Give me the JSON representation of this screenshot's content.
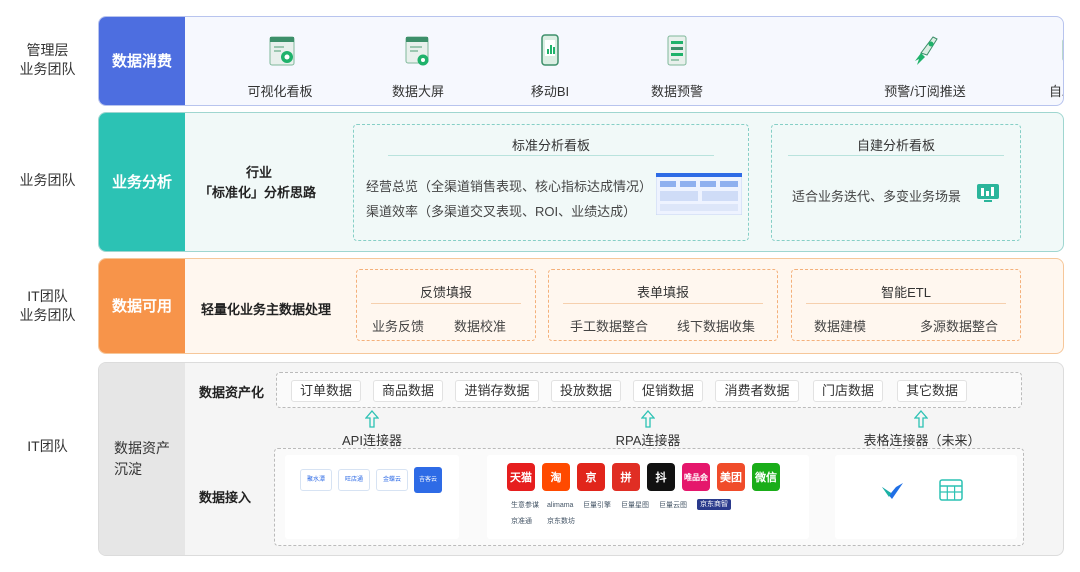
{
  "row_labels": {
    "management": [
      "管理层",
      "业务团队"
    ],
    "business": [
      "业务团队"
    ],
    "it_business": [
      "IT团队",
      "业务团队"
    ],
    "it": [
      "IT团队"
    ]
  },
  "consumption": {
    "tag": "数据消费",
    "items": [
      "可视化看板",
      "数据大屏",
      "移动BI",
      "数据预警",
      "预警/订阅推送",
      "自助分析"
    ],
    "icons": [
      "dashboard-icon",
      "big-screen-icon",
      "mobile-bi-icon",
      "alert-icon",
      "push-rocket-icon",
      "self-analysis-icon"
    ]
  },
  "analysis": {
    "tag": "业务分析",
    "left_title_1": "行业",
    "left_title_2": "「标准化」分析思路",
    "standard": {
      "title": "标准分析看板",
      "line1": "经营总览（全渠道销售表现、核心指标达成情况）",
      "line2": "渠道效率（多渠道交叉表现、ROI、业绩达成）"
    },
    "custom": {
      "title": "自建分析看板",
      "line1": "适合业务迭代、多变业务场景"
    }
  },
  "available": {
    "tag": "数据可用",
    "left_title": "轻量化业务主数据处理",
    "boxes": [
      {
        "title": "反馈填报",
        "items": [
          "业务反馈",
          "数据校准"
        ]
      },
      {
        "title": "表单填报",
        "items": [
          "手工数据整合",
          "线下数据收集"
        ]
      },
      {
        "title": "智能ETL",
        "items": [
          "数据建模",
          "多源数据整合"
        ]
      }
    ]
  },
  "assets": {
    "tag_1": "数据资产",
    "tag_2": "沉淀",
    "assetize_label": "数据资产化",
    "chips": [
      "订单数据",
      "商品数据",
      "进销存数据",
      "投放数据",
      "促销数据",
      "消费者数据",
      "门店数据",
      "其它数据"
    ],
    "connectors": [
      "API连接器",
      "RPA连接器",
      "表格连接器（未来）"
    ],
    "ingest_label": "数据接入",
    "api_logos": [
      "聚水潭",
      "旺店通",
      "金蝶云",
      "吉客云"
    ],
    "rpa_logos": [
      {
        "text": "天猫",
        "color": "#e61e1e"
      },
      {
        "text": "淘",
        "color": "#ff4a00"
      },
      {
        "text": "京",
        "color": "#e1251b"
      },
      {
        "text": "拼",
        "color": "#e02e24"
      },
      {
        "text": "抖",
        "color": "#111111"
      },
      {
        "text": "唯品会",
        "color": "#e5176c"
      },
      {
        "text": "美团",
        "color": "#f04c2a"
      },
      {
        "text": "微信",
        "color": "#1aad19"
      }
    ],
    "rpa_small": [
      "生意参谋",
      "alimama",
      "巨量引擎",
      "巨量星图",
      "巨量云图",
      "京东商智",
      "京准通",
      "京东数坊"
    ]
  }
}
